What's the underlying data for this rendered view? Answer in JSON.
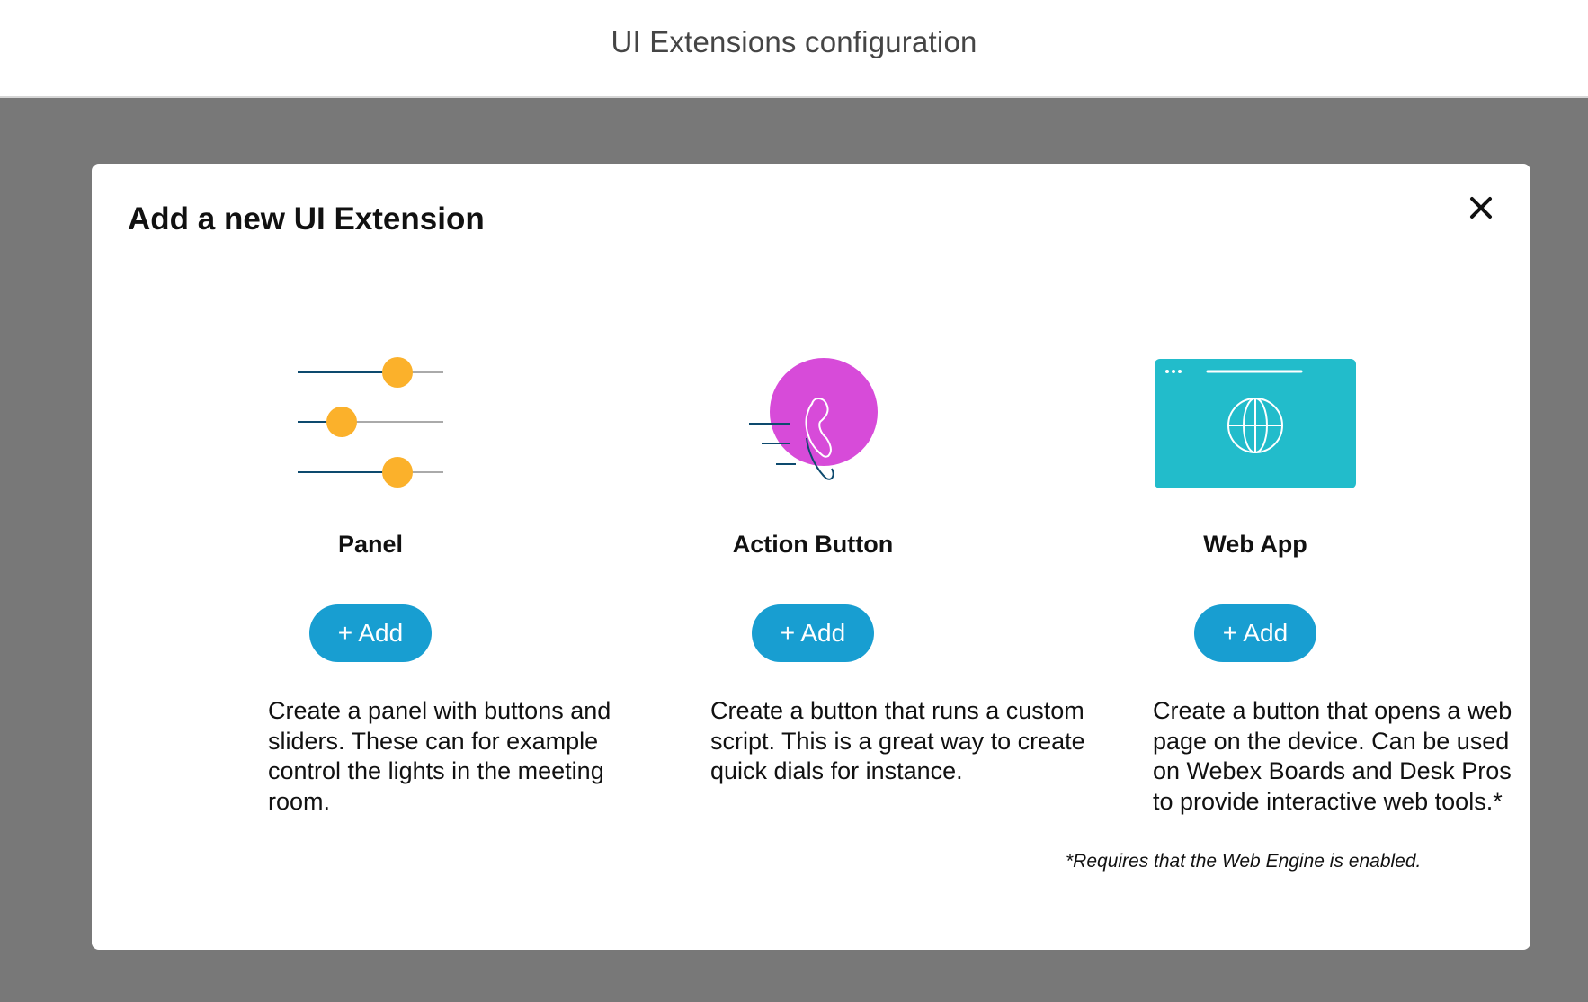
{
  "header": {
    "title": "UI Extensions configuration"
  },
  "modal": {
    "title": "Add a new UI Extension",
    "close_icon": "close-icon",
    "cards": [
      {
        "title": "Panel",
        "icon": "sliders-icon",
        "add_label": "+ Add",
        "description": "Create a panel with buttons and sliders. These can for example control the lights in the meeting room."
      },
      {
        "title": "Action Button",
        "icon": "phone-action-icon",
        "add_label": "+ Add",
        "description": "Create a button that runs a custom script. This is a great way to create quick dials for instance."
      },
      {
        "title": "Web App",
        "icon": "browser-globe-icon",
        "add_label": "+ Add",
        "description": "Create a button that opens a web page on the device. Can be used on Webex Boards and Desk Pros to provide interactive web tools.*",
        "footnote": "*Requires that the Web Engine is enabled."
      }
    ]
  },
  "colors": {
    "overlay": "#787878",
    "slider_knob": "#fbb12b",
    "slider_track": "#0d4a6e",
    "action_circle": "#d74bd9",
    "webapp_bg": "#22bccb",
    "button_bg": "#189ed1"
  }
}
